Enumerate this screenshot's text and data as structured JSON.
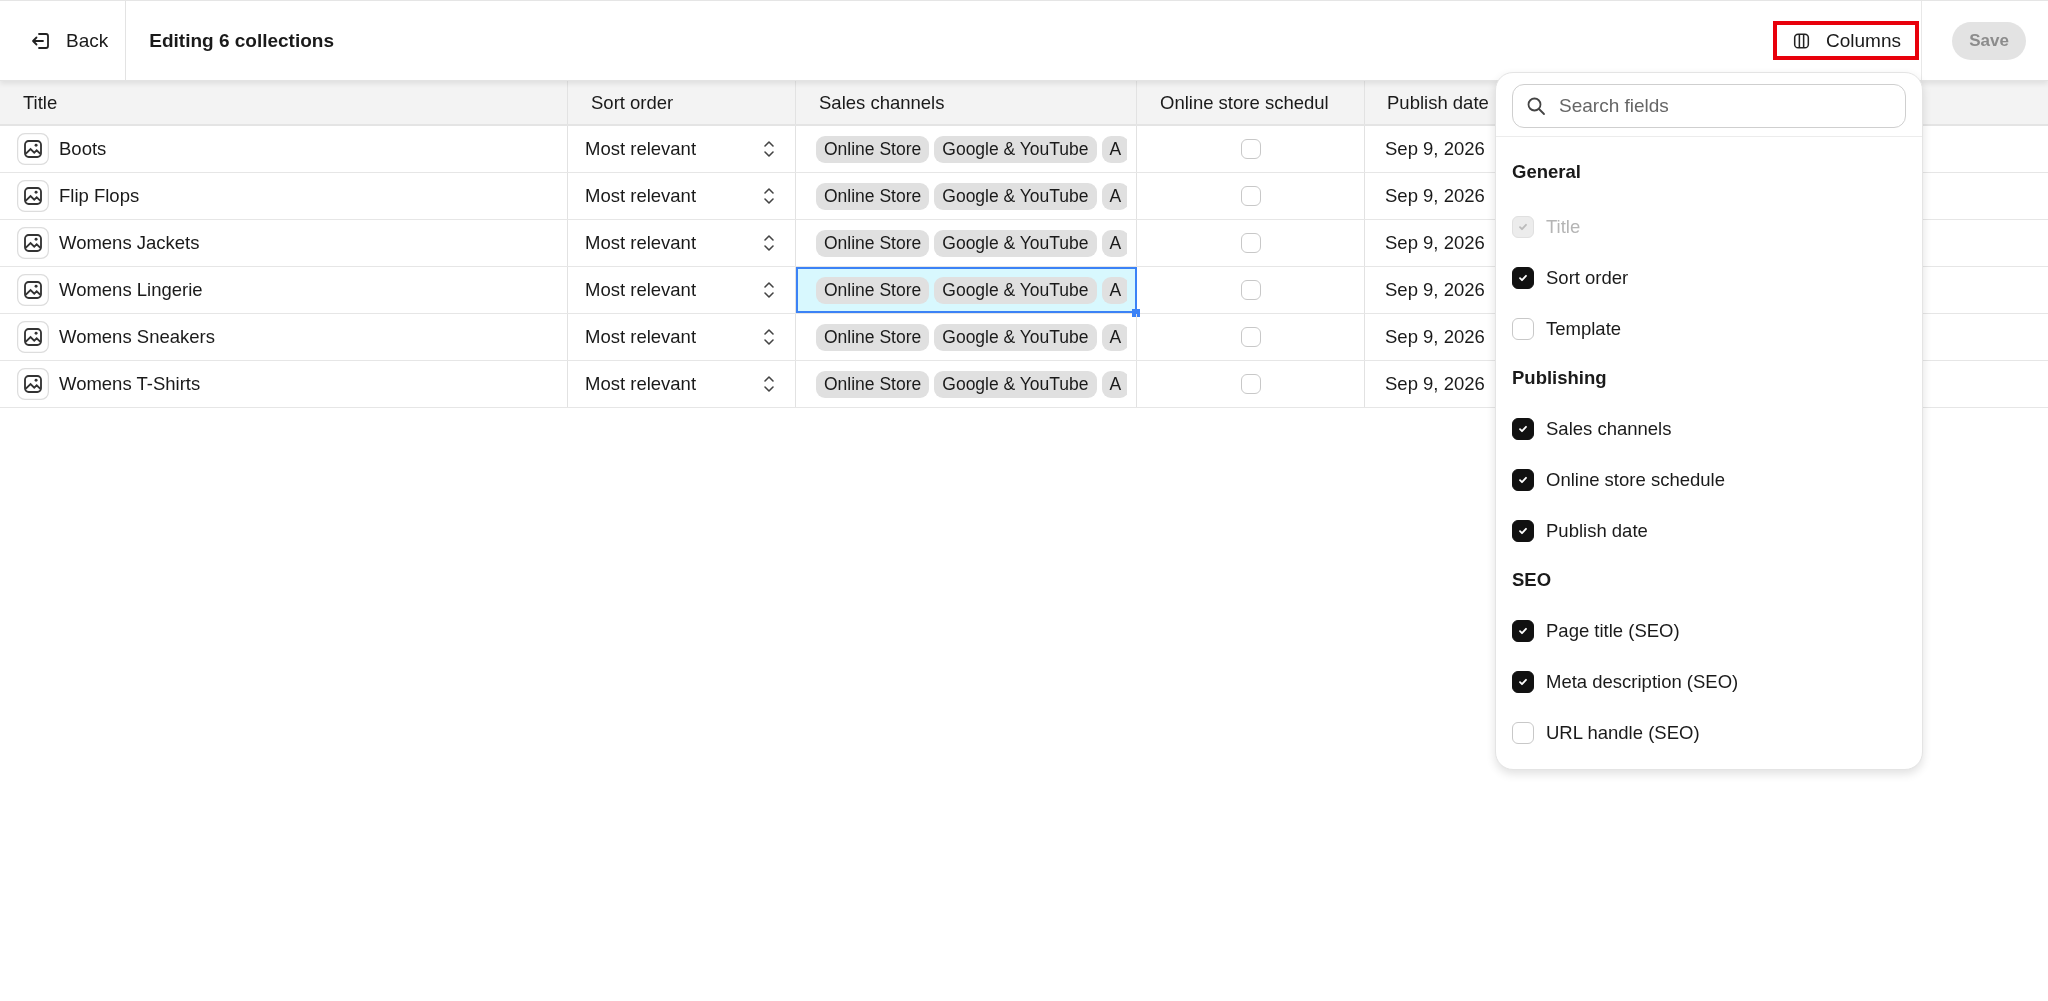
{
  "header": {
    "back": "Back",
    "title": "Editing 6 collections",
    "columns_button": "Columns",
    "save": {
      "label": "Save",
      "disabled": true
    }
  },
  "table": {
    "columns": [
      "Title",
      "Sort order",
      "Sales channels",
      "Online store schedul",
      "Publish date"
    ],
    "rows": [
      {
        "title": "Boots",
        "sort_order": "Most relevant",
        "channels": [
          "Online Store",
          "Google & YouTube",
          "A"
        ],
        "channels_selected": false,
        "scheduled": false,
        "publish_date": "Sep 9, 2026"
      },
      {
        "title": "Flip Flops",
        "sort_order": "Most relevant",
        "channels": [
          "Online Store",
          "Google & YouTube",
          "A"
        ],
        "channels_selected": false,
        "scheduled": false,
        "publish_date": "Sep 9, 2026"
      },
      {
        "title": "Womens Jackets",
        "sort_order": "Most relevant",
        "channels": [
          "Online Store",
          "Google & YouTube",
          "A"
        ],
        "channels_selected": false,
        "scheduled": false,
        "publish_date": "Sep 9, 2026"
      },
      {
        "title": "Womens Lingerie",
        "sort_order": "Most relevant",
        "channels": [
          "Online Store",
          "Google & YouTube",
          "A"
        ],
        "channels_selected": true,
        "scheduled": false,
        "publish_date": "Sep 9, 2026"
      },
      {
        "title": "Womens Sneakers",
        "sort_order": "Most relevant",
        "channels": [
          "Online Store",
          "Google & YouTube",
          "A"
        ],
        "channels_selected": false,
        "scheduled": false,
        "publish_date": "Sep 9, 2026"
      },
      {
        "title": "Womens T-Shirts",
        "sort_order": "Most relevant",
        "channels": [
          "Online Store",
          "Google & YouTube",
          "A"
        ],
        "channels_selected": false,
        "scheduled": false,
        "publish_date": "Sep 9, 2026"
      }
    ]
  },
  "columns_menu": {
    "search": {
      "placeholder": "Search fields"
    },
    "groups": [
      {
        "heading": "General",
        "items": [
          {
            "label": "Title",
            "checked": true,
            "disabled": true
          },
          {
            "label": "Sort order",
            "checked": true,
            "disabled": false
          },
          {
            "label": "Template",
            "checked": false,
            "disabled": false
          }
        ]
      },
      {
        "heading": "Publishing",
        "items": [
          {
            "label": "Sales channels",
            "checked": true,
            "disabled": false
          },
          {
            "label": "Online store schedule",
            "checked": true,
            "disabled": false
          },
          {
            "label": "Publish date",
            "checked": true,
            "disabled": false
          }
        ]
      },
      {
        "heading": "SEO",
        "items": [
          {
            "label": "Page title (SEO)",
            "checked": true,
            "disabled": false
          },
          {
            "label": "Meta description (SEO)",
            "checked": true,
            "disabled": false
          },
          {
            "label": "URL handle (SEO)",
            "checked": false,
            "disabled": false
          }
        ]
      }
    ]
  }
}
